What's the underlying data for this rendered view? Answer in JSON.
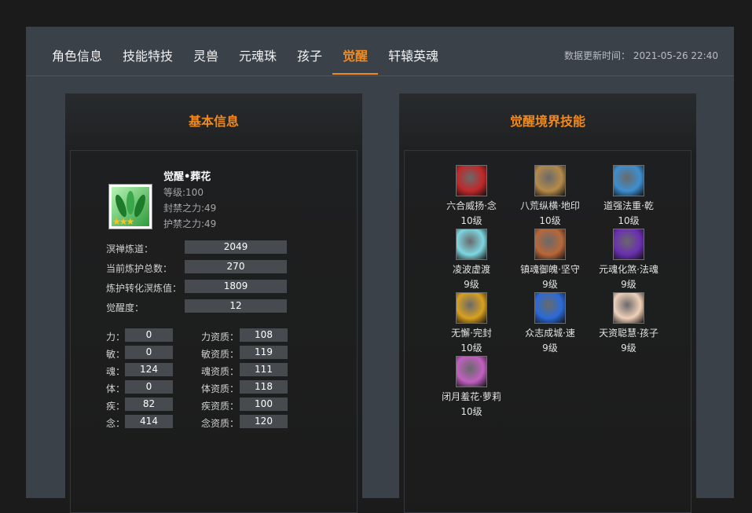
{
  "tabs": [
    {
      "label": "角色信息",
      "active": false
    },
    {
      "label": "技能特技",
      "active": false
    },
    {
      "label": "灵兽",
      "active": false
    },
    {
      "label": "元魂珠",
      "active": false
    },
    {
      "label": "孩子",
      "active": false
    },
    {
      "label": "觉醒",
      "active": true
    },
    {
      "label": "轩辕英魂",
      "active": false
    }
  ],
  "update_time": "数据更新时间： 2021-05-26 22:40",
  "accent_color": "#f08a1e",
  "basic": {
    "title": "基本信息",
    "name": "觉醒•葬花",
    "level": "等级:100",
    "seal": "封禁之力:49",
    "guard": "护禁之力:49",
    "stats": [
      {
        "label": "溟禅炼道：",
        "value": "2049"
      },
      {
        "label": "当前炼护总数：",
        "value": "270"
      },
      {
        "label": "炼护转化溟炼值：",
        "value": "1809"
      },
      {
        "label": "觉醒度：",
        "value": "12"
      }
    ],
    "attrs": [
      {
        "label": "力：",
        "value": "0",
        "q_label": "力资质：",
        "q_value": "108"
      },
      {
        "label": "敏：",
        "value": "0",
        "q_label": "敏资质：",
        "q_value": "119"
      },
      {
        "label": "魂：",
        "value": "124",
        "q_label": "魂资质：",
        "q_value": "111"
      },
      {
        "label": "体：",
        "value": "0",
        "q_label": "体资质：",
        "q_value": "118"
      },
      {
        "label": "疾：",
        "value": "82",
        "q_label": "疾资质：",
        "q_value": "100"
      },
      {
        "label": "念：",
        "value": "414",
        "q_label": "念资质：",
        "q_value": "120"
      }
    ]
  },
  "skills": {
    "title": "觉醒境界技能",
    "items": [
      {
        "name": "六合威扬·念",
        "level": "10级",
        "icon": "red-claw-icon",
        "color": "#c0282a"
      },
      {
        "name": "八荒纵横·地印",
        "level": "10级",
        "icon": "earth-seal-icon",
        "color": "#b58a4a"
      },
      {
        "name": "道强法重·乾",
        "level": "10级",
        "icon": "blue-sword-icon",
        "color": "#3d8fd0"
      },
      {
        "name": "凌波虚渡",
        "level": "9级",
        "icon": "water-wave-icon",
        "color": "#7fd6e0"
      },
      {
        "name": "镇魂御魄·坚守",
        "level": "9级",
        "icon": "warrior-face-icon",
        "color": "#b8683a"
      },
      {
        "name": "元魂化煞·法魂",
        "level": "9级",
        "icon": "purple-demon-icon",
        "color": "#6a2fb0"
      },
      {
        "name": "无懈·完封",
        "level": "10级",
        "icon": "golden-shield-icon",
        "color": "#d8a020"
      },
      {
        "name": "众志成城·速",
        "level": "9级",
        "icon": "blue-fighter-icon",
        "color": "#2a6ad8"
      },
      {
        "name": "天资聪慧·孩子",
        "level": "9级",
        "icon": "baby-face-icon",
        "color": "#f0d0b8"
      },
      {
        "name": "闭月羞花·萝莉",
        "level": "10级",
        "icon": "girl-portrait-icon",
        "color": "#c060c0"
      }
    ]
  }
}
